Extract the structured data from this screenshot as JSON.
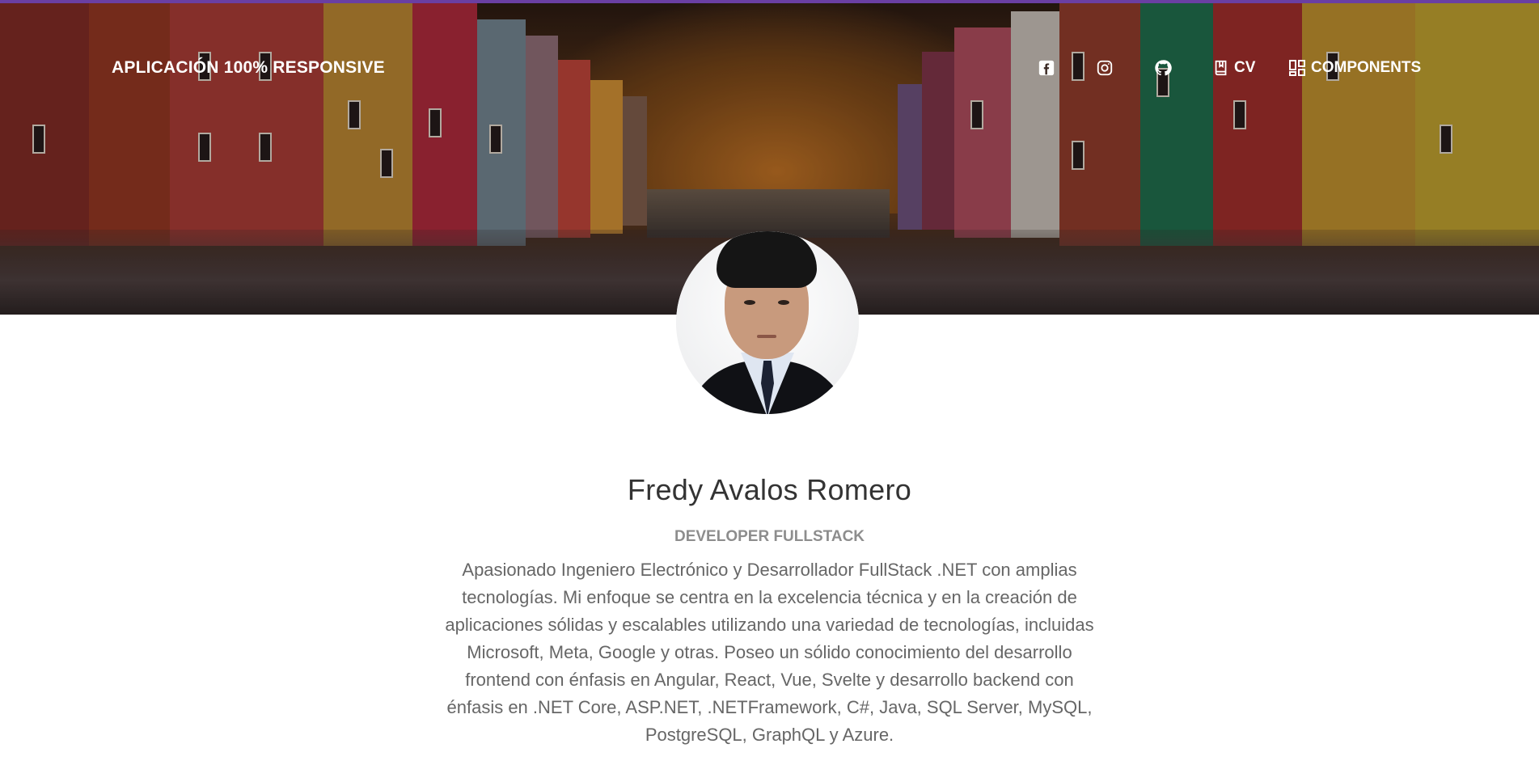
{
  "navbar": {
    "brand": "APLICACIÓN 100% RESPONSIVE",
    "links": [
      {
        "icon": "facebook-icon",
        "label": ""
      },
      {
        "icon": "instagram-icon",
        "label": ""
      },
      {
        "icon": "github-icon",
        "label": ""
      },
      {
        "icon": "book-icon",
        "label": "CV"
      },
      {
        "icon": "components-icon",
        "label": "COMPONENTS"
      }
    ]
  },
  "profile": {
    "name": "Fredy Avalos Romero",
    "role": "DEVELOPER FULLSTACK",
    "bio": "Apasionado Ingeniero Electrónico y Desarrollador FullStack .NET con amplias tecnologías. Mi enfoque se centra en la excelencia técnica y en la creación de aplicaciones sólidas y escalables utilizando una variedad de tecnologías, incluidas Microsoft, Meta, Google y otras. Poseo un sólido conocimiento del desarrollo frontend con énfasis en Angular, React, Vue, Svelte y desarrollo backend con énfasis en .NET Core, ASP.NET, .NETFramework, C#, Java, SQL Server, MySQL, PostgreSQL, GraphQL y Azure."
  },
  "colors": {
    "accent": "#6a3fa3",
    "heading": "#333333",
    "subtitle": "#8d8d8d",
    "body_text": "#666666"
  }
}
